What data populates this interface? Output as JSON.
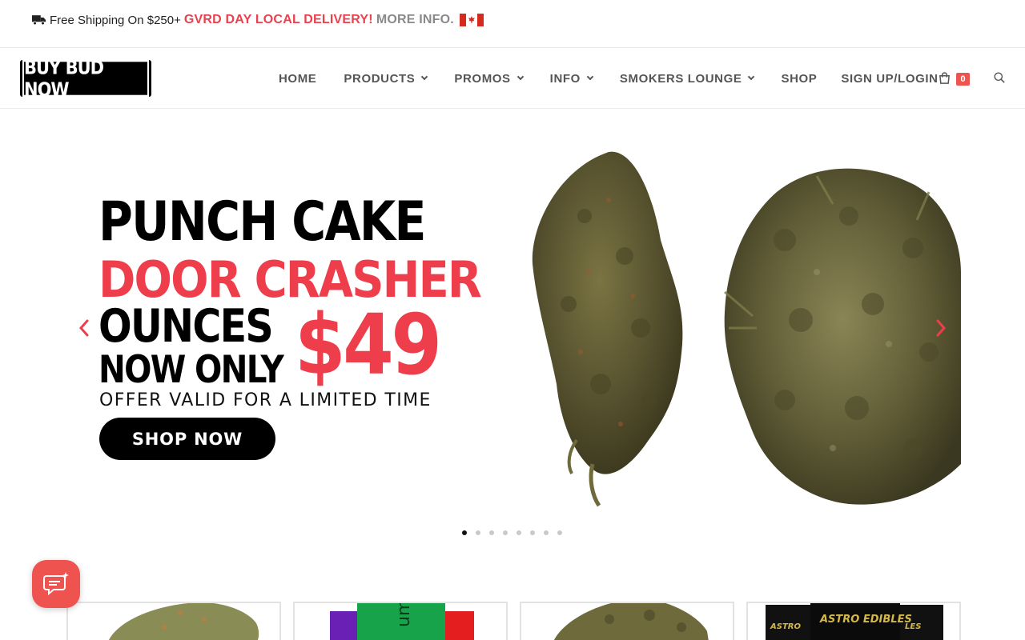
{
  "topbar": {
    "shipping_text": "Free Shipping On $250+",
    "delivery_text": "GVRD DAY LOCAL DELIVERY!",
    "more_info_text": "MORE INFO.",
    "flag_icon": "canada-flag-icon"
  },
  "header": {
    "logo_text": "BUY BUD NOW",
    "nav": [
      {
        "label": "HOME",
        "has_dropdown": false
      },
      {
        "label": "PRODUCTS",
        "has_dropdown": true
      },
      {
        "label": "PROMOS",
        "has_dropdown": true
      },
      {
        "label": "INFO",
        "has_dropdown": true
      },
      {
        "label": "SMOKERS LOUNGE",
        "has_dropdown": true
      },
      {
        "label": "SHOP",
        "has_dropdown": false
      },
      {
        "label": "SIGN UP/LOGIN",
        "has_dropdown": false
      }
    ],
    "cart_count": "0",
    "cart_icon": "shopping-bag-icon",
    "search_icon": "search-icon"
  },
  "hero": {
    "line1": "PUNCH CAKE",
    "line2": "DOOR CRASHER",
    "line3": "OUNCES",
    "line4": "NOW ONLY",
    "price": "$49",
    "offer": "OFFER VALID FOR A LIMITED TIME",
    "button_label": "SHOP NOW",
    "slide_count": 8,
    "active_slide": 1
  },
  "colors": {
    "accent_red": "#ee3e4b",
    "badge_red": "#ef5350",
    "text_dark": "#000000",
    "nav_grey": "#555555"
  }
}
